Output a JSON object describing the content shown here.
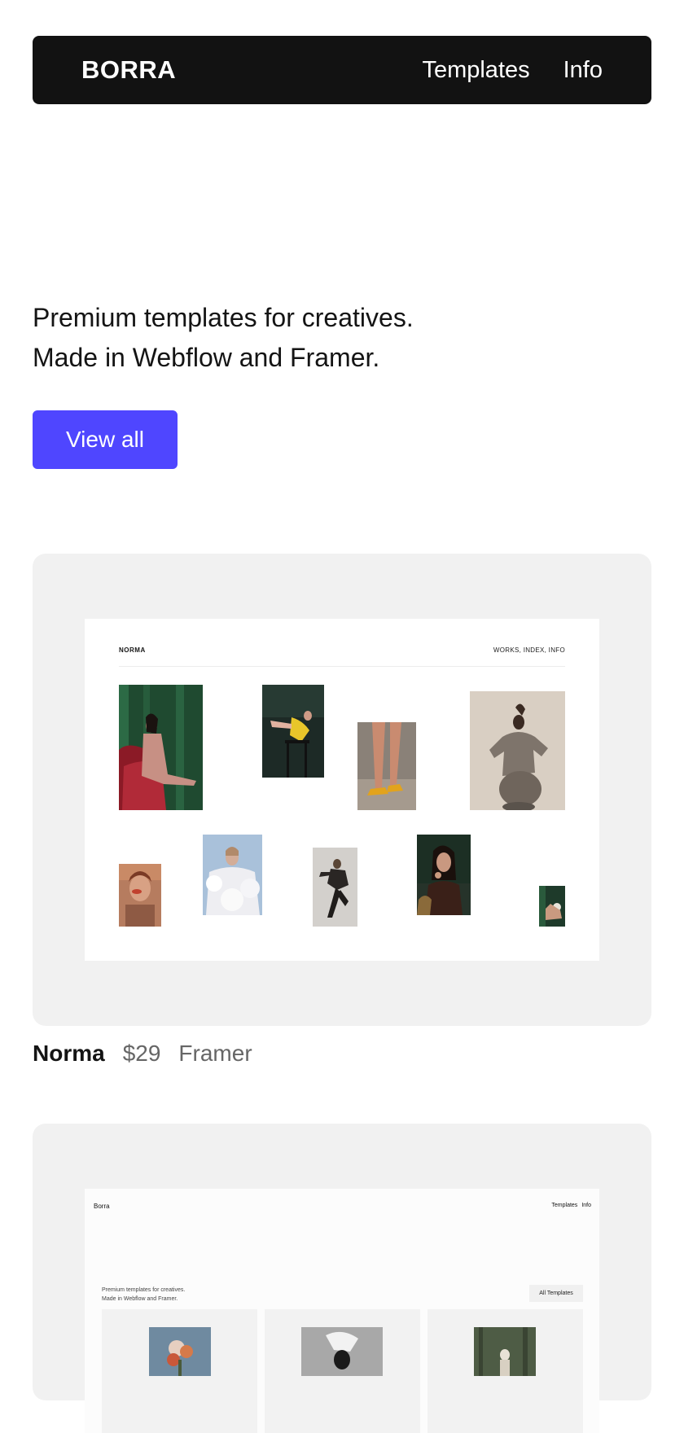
{
  "header": {
    "brand": "BORRA",
    "nav": [
      "Templates",
      "Info"
    ]
  },
  "hero": {
    "line1": "Premium templates for creatives.",
    "line2": "Made in Webflow and Framer.",
    "cta": "View all"
  },
  "templates": [
    {
      "name": "Norma",
      "price": "$29",
      "platform": "Framer",
      "preview": {
        "brand": "NORMA",
        "links": "WORKS, INDEX, INFO"
      }
    },
    {
      "preview": {
        "brand": "Borra",
        "links": [
          "Templates",
          "Info"
        ],
        "hero_line1": "Premium templates for creatives.",
        "hero_line2": "Made in Webflow and Framer.",
        "button": "All Templates"
      }
    }
  ],
  "colors": {
    "navbar_bg": "#121212",
    "accent": "#4f46ff",
    "card_bg": "#f1f1f1",
    "muted_text": "#666666"
  }
}
